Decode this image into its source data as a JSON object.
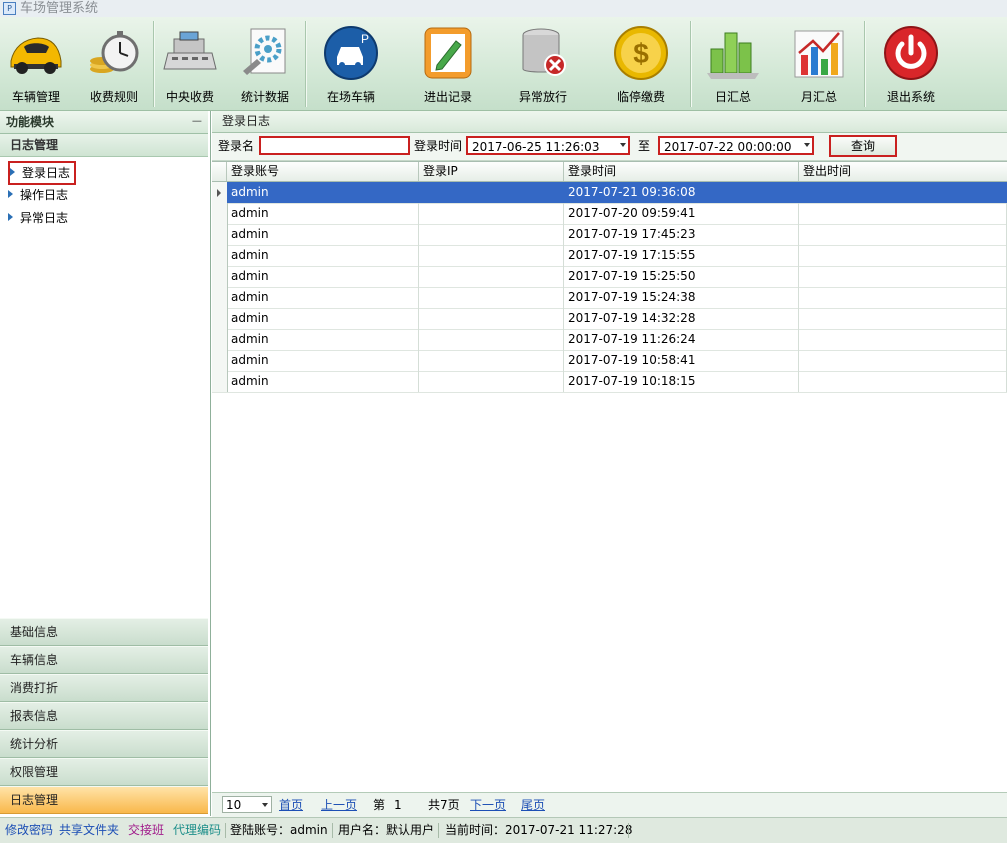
{
  "window": {
    "title": "车场管理系统"
  },
  "toolbar": {
    "items": [
      {
        "label": "车辆管理",
        "icon": "sports-car-icon"
      },
      {
        "label": "收费规则",
        "icon": "stopwatch-coins-icon"
      },
      {
        "label": "中央收费",
        "icon": "cash-register-icon"
      },
      {
        "label": "统计数据",
        "icon": "settings-gear-document-icon"
      },
      {
        "label": "在场车辆",
        "icon": "parking-car-icon"
      },
      {
        "label": "进出记录",
        "icon": "notepad-pencil-icon"
      },
      {
        "label": "异常放行",
        "icon": "database-error-icon"
      },
      {
        "label": "临停缴费",
        "icon": "dollar-coin-icon"
      },
      {
        "label": "日汇总",
        "icon": "green-bar-blocks-icon"
      },
      {
        "label": "月汇总",
        "icon": "bar-chart-icon"
      },
      {
        "label": "退出系统",
        "icon": "power-button-icon"
      }
    ]
  },
  "sidebar": {
    "header": "功能模块",
    "pin": "ᅳ",
    "open_group": "日志管理",
    "items": [
      {
        "label": "登录日志"
      },
      {
        "label": "操作日志"
      },
      {
        "label": "异常日志"
      }
    ],
    "groups": [
      {
        "label": "基础信息"
      },
      {
        "label": "车辆信息"
      },
      {
        "label": "消费打折"
      },
      {
        "label": "报表信息"
      },
      {
        "label": "统计分析"
      },
      {
        "label": "权限管理"
      },
      {
        "label": "日志管理"
      }
    ]
  },
  "panel": {
    "title": "登录日志"
  },
  "search": {
    "name_label": "登录名",
    "name_value": "",
    "time_label": "登录时间",
    "from_value": "2017-06-25 11:26:03",
    "to_label": "至",
    "to_value": "2017-07-22 00:00:00",
    "button": "查询"
  },
  "grid": {
    "columns": [
      "登录账号",
      "登录IP",
      "登录时间",
      "登出时间"
    ],
    "rows": [
      {
        "account": "admin",
        "ip": "",
        "login": "2017-07-21 09:36:08",
        "logout": ""
      },
      {
        "account": "admin",
        "ip": "",
        "login": "2017-07-20 09:59:41",
        "logout": ""
      },
      {
        "account": "admin",
        "ip": "",
        "login": "2017-07-19 17:45:23",
        "logout": ""
      },
      {
        "account": "admin",
        "ip": "",
        "login": "2017-07-19 17:15:55",
        "logout": ""
      },
      {
        "account": "admin",
        "ip": "",
        "login": "2017-07-19 15:25:50",
        "logout": ""
      },
      {
        "account": "admin",
        "ip": "",
        "login": "2017-07-19 15:24:38",
        "logout": ""
      },
      {
        "account": "admin",
        "ip": "",
        "login": "2017-07-19 14:32:28",
        "logout": ""
      },
      {
        "account": "admin",
        "ip": "",
        "login": "2017-07-19 11:26:24",
        "logout": ""
      },
      {
        "account": "admin",
        "ip": "",
        "login": "2017-07-19 10:58:41",
        "logout": ""
      },
      {
        "account": "admin",
        "ip": "",
        "login": "2017-07-19 10:18:15",
        "logout": ""
      }
    ]
  },
  "pager": {
    "page_size": "10",
    "first": "首页",
    "prev": "上一页",
    "page_prefix": "第",
    "page_number": "1",
    "total": "共7页",
    "next": "下一页",
    "last": "尾页"
  },
  "status": {
    "change_password": "修改密码",
    "shared_folder": "共享文件夹",
    "handover": "交接班",
    "agent_code": "代理编码",
    "login_account": "登陆账号：admin",
    "user_name": "用户名：默认用户",
    "current_time": "当前时间：2017-07-21 11:27:28",
    "colors": {
      "change_password": "#1d4fb5",
      "shared_folder": "#1d4fb5",
      "handover": "#a0198a",
      "agent_code": "#1e8f8a"
    }
  }
}
